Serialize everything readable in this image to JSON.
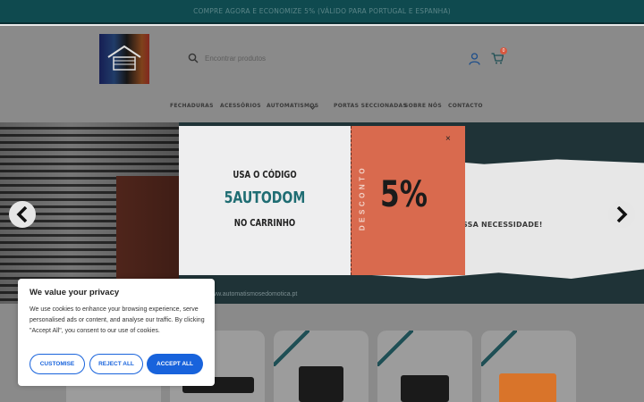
{
  "promo_bar": {
    "text": "COMPRE AGORA E ECONOMIZE 5% (VÁLIDO PARA PORTUGAL E ESPANHA)"
  },
  "header": {
    "search_placeholder": "Encontrar produtos",
    "cart_count": "0"
  },
  "nav": {
    "items": [
      {
        "label": "FECHADURAS"
      },
      {
        "label": "ACESSÓRIOS"
      },
      {
        "label": "AUTOMATISMOS"
      },
      {
        "label": "PORTAS SECCIONADAS"
      },
      {
        "label": "SOBRE NÓS"
      },
      {
        "label": "CONTACTO"
      }
    ]
  },
  "hero": {
    "paper_text": "OSSA NECESSIDADE!",
    "site_text": "www.automatismosedomotica.pt"
  },
  "popup": {
    "line1": "USA O CÓDIGO",
    "code": "5AUTODOM",
    "line3": "NO CARRINHO",
    "vertical_label": "DESCONTO",
    "percent": "5%",
    "close": "×"
  },
  "cookie": {
    "title": "We value your privacy",
    "body": "We use cookies to enhance your browsing experience, serve personalised ads or content, and analyse our traffic. By clicking \"Accept All\", you consent to our use of cookies.",
    "customise": "CUSTOMISE",
    "reject": "REJECT ALL",
    "accept": "ACCEPT ALL"
  },
  "colors": {
    "promo_bg": "#0f4a4f",
    "popup_accent": "#d96a4e",
    "code_color": "#1f6d73",
    "button_blue": "#1863dc"
  }
}
